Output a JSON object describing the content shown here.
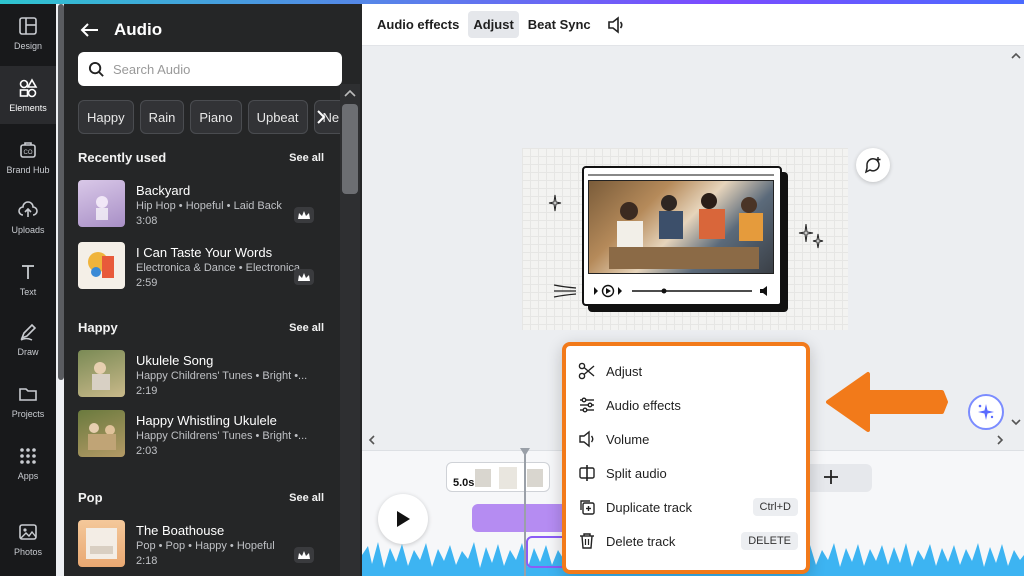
{
  "rail": [
    {
      "label": "Design",
      "icon": "layout-icon"
    },
    {
      "label": "Elements",
      "icon": "shapes-icon",
      "active": true
    },
    {
      "label": "Brand Hub",
      "icon": "brand-icon"
    },
    {
      "label": "Uploads",
      "icon": "cloud-upload-icon"
    },
    {
      "label": "Text",
      "icon": "text-icon"
    },
    {
      "label": "Draw",
      "icon": "pen-icon"
    },
    {
      "label": "Projects",
      "icon": "folder-icon"
    },
    {
      "label": "Apps",
      "icon": "grid-icon"
    },
    {
      "label": "Photos",
      "icon": "photo-icon"
    }
  ],
  "panel": {
    "title": "Audio",
    "search_placeholder": "Search Audio",
    "chips": [
      "Happy",
      "Rain",
      "Piano",
      "Upbeat",
      "Ne"
    ],
    "sections": [
      {
        "title": "Recently used",
        "see_all": "See all",
        "tracks": [
          {
            "title": "Backyard",
            "meta": "Hip Hop • Hopeful • Laid Back",
            "duration": "3:08"
          },
          {
            "title": "I Can Taste Your Words",
            "meta": "Electronica & Dance • Electronica ...",
            "duration": "2:59"
          }
        ]
      },
      {
        "title": "Happy",
        "see_all": "See all",
        "tracks": [
          {
            "title": "Ukulele Song",
            "meta": "Happy Childrens' Tunes • Bright •...",
            "duration": "2:19"
          },
          {
            "title": "Happy Whistling Ukulele",
            "meta": "Happy Childrens' Tunes • Bright •...",
            "duration": "2:03"
          }
        ]
      },
      {
        "title": "Pop",
        "see_all": "See all",
        "tracks": [
          {
            "title": "The Boathouse",
            "meta": "Pop • Pop • Happy • Hopeful",
            "duration": "2:18"
          }
        ]
      }
    ]
  },
  "toolbar": {
    "audio_effects": "Audio effects",
    "adjust": "Adjust",
    "beat_sync": "Beat Sync"
  },
  "context_menu": [
    {
      "label": "Adjust",
      "icon": "scissors-icon"
    },
    {
      "label": "Audio effects",
      "icon": "sliders-icon"
    },
    {
      "label": "Volume",
      "icon": "volume-icon"
    },
    {
      "label": "Split audio",
      "icon": "split-icon"
    },
    {
      "label": "Duplicate track",
      "icon": "duplicate-icon",
      "shortcut": "Ctrl+D"
    },
    {
      "label": "Delete track",
      "icon": "trash-icon",
      "shortcut": "DELETE"
    }
  ],
  "timeline": {
    "clip_duration": "5.0s"
  },
  "colors": {
    "accent_orange": "#f27a1a",
    "purple": "#8b5cf6",
    "wave_blue": "#3db4f2"
  }
}
